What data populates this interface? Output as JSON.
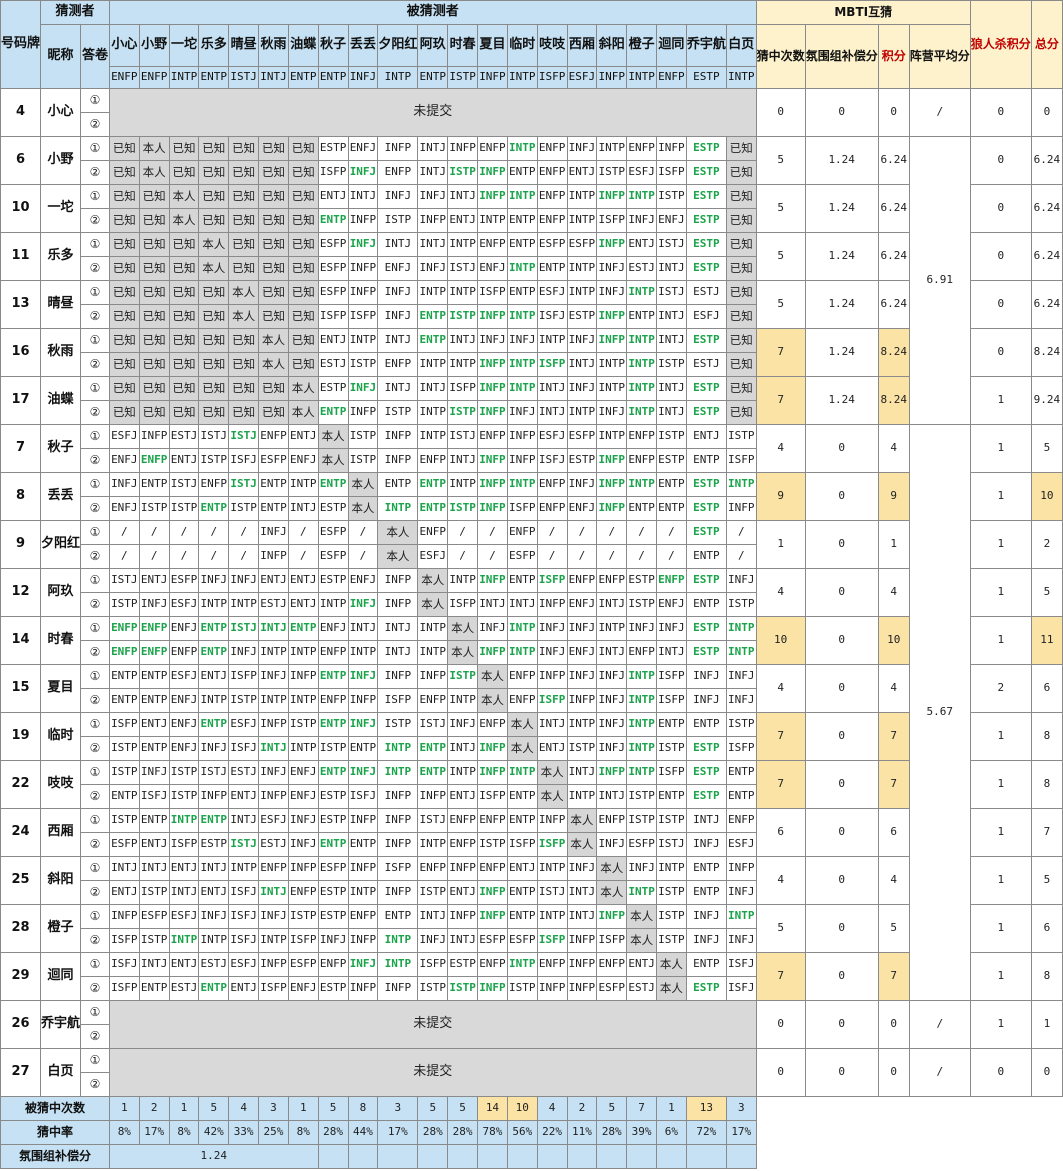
{
  "headers": {
    "id": "号码牌",
    "guesser": "猜测者",
    "nickname": "昵称",
    "sheet": "答卷",
    "guessed": "被猜测者",
    "mbti_section": "MBTI互猜",
    "hits": "猜中次数",
    "atmosphere": "氛围组补偿分",
    "points": "积分",
    "faction_avg": "阵营平均分",
    "wolf_points": "狼人杀积分",
    "total": "总分",
    "sheet_1": "①",
    "sheet_2": "②"
  },
  "columns": [
    {
      "name": "小心",
      "type": "ENFP"
    },
    {
      "name": "小野",
      "type": "ENFP"
    },
    {
      "name": "一坨",
      "type": "INTP"
    },
    {
      "name": "乐多",
      "type": "ENTP"
    },
    {
      "name": "晴昼",
      "type": "ISTJ"
    },
    {
      "name": "秋雨",
      "type": "INTJ"
    },
    {
      "name": "油蝶",
      "type": "ENTP"
    },
    {
      "name": "秋子",
      "type": "ENTP"
    },
    {
      "name": "丢丢",
      "type": "INFJ"
    },
    {
      "name": "夕阳红",
      "type": "INTP"
    },
    {
      "name": "阿玖",
      "type": "ENTP"
    },
    {
      "name": "时春",
      "type": "ISTP"
    },
    {
      "name": "夏目",
      "type": "INFP"
    },
    {
      "name": "临时",
      "type": "INTP"
    },
    {
      "name": "吱吱",
      "type": "ISFP"
    },
    {
      "name": "西厢",
      "type": "ESFJ"
    },
    {
      "name": "斜阳",
      "type": "INFP"
    },
    {
      "name": "橙子",
      "type": "INTP"
    },
    {
      "name": "迴同",
      "type": "ENFP"
    },
    {
      "name": "乔宇航",
      "type": "ESTP"
    },
    {
      "name": "白页",
      "type": "INTP"
    }
  ],
  "players": [
    {
      "id": "4",
      "name": "小心",
      "not_submitted": true,
      "not_submitted_label": "未提交",
      "hits": "0",
      "atmo": "0",
      "points": "0",
      "avg": "/",
      "wolf": "0",
      "total": "0"
    },
    {
      "id": "6",
      "name": "小野",
      "hits": "5",
      "atmo": "1.24",
      "points": "6.24",
      "wolf": "0",
      "total": "6.24",
      "s1": [
        "已知",
        "本人",
        "已知",
        "已知",
        "已知",
        "已知",
        "已知",
        "ESTP",
        "ENFJ",
        "INFP",
        "INTJ",
        "INFP",
        "ENFP",
        "INTP",
        "ENFP",
        "INFJ",
        "INTP",
        "ENFP",
        "INFP",
        "ESTP",
        "已知"
      ],
      "s2": [
        "已知",
        "本人",
        "已知",
        "已知",
        "已知",
        "已知",
        "已知",
        "ISFP",
        "INFJ",
        "ENFP",
        "INTJ",
        "ISTP",
        "INFP",
        "ENTP",
        "ENFP",
        "ENTJ",
        "ISTP",
        "ESFJ",
        "ISFP",
        "ESTP",
        "已知"
      ]
    },
    {
      "id": "10",
      "name": "一坨",
      "hits": "5",
      "atmo": "1.24",
      "points": "6.24",
      "wolf": "0",
      "total": "6.24",
      "s1": [
        "已知",
        "已知",
        "本人",
        "已知",
        "已知",
        "已知",
        "已知",
        "ENTJ",
        "INTJ",
        "INFJ",
        "INFJ",
        "INTJ",
        "INFP",
        "INTP",
        "ENFP",
        "INTP",
        "INFP",
        "INTP",
        "ISTP",
        "ESTP",
        "已知"
      ],
      "s2": [
        "已知",
        "已知",
        "本人",
        "已知",
        "已知",
        "已知",
        "已知",
        "ENTP",
        "INFP",
        "ISTP",
        "INFP",
        "ENTJ",
        "INTP",
        "ENTP",
        "ENFP",
        "INTP",
        "ISFP",
        "INFJ",
        "ENFJ",
        "ESTP",
        "已知"
      ]
    },
    {
      "id": "11",
      "name": "乐多",
      "hits": "5",
      "atmo": "1.24",
      "points": "6.24",
      "wolf": "0",
      "total": "6.24",
      "s1": [
        "已知",
        "已知",
        "已知",
        "本人",
        "已知",
        "已知",
        "已知",
        "ESFP",
        "INFJ",
        "INTJ",
        "INTJ",
        "INTP",
        "ENFP",
        "ENTP",
        "ESFP",
        "ESFP",
        "INFP",
        "ENTJ",
        "ISTJ",
        "ESTP",
        "已知"
      ],
      "s2": [
        "已知",
        "已知",
        "已知",
        "本人",
        "已知",
        "已知",
        "已知",
        "ESFP",
        "INFP",
        "ENFJ",
        "INFJ",
        "ISTJ",
        "ENFJ",
        "INTP",
        "ENTP",
        "INTP",
        "INFJ",
        "ESTJ",
        "INTJ",
        "ESTP",
        "已知"
      ]
    },
    {
      "id": "13",
      "name": "晴昼",
      "hits": "5",
      "atmo": "1.24",
      "points": "6.24",
      "wolf": "0",
      "total": "6.24",
      "s1": [
        "已知",
        "已知",
        "已知",
        "已知",
        "本人",
        "已知",
        "已知",
        "ESFP",
        "INFP",
        "INFJ",
        "INTP",
        "INTP",
        "ISFP",
        "ENTP",
        "ESFJ",
        "INTP",
        "INFJ",
        "INTP",
        "ISTJ",
        "ESTJ",
        "已知"
      ],
      "s2": [
        "已知",
        "已知",
        "已知",
        "已知",
        "本人",
        "已知",
        "已知",
        "ISFP",
        "ISFP",
        "INFJ",
        "ENTP",
        "ISTP",
        "INFP",
        "INTP",
        "ISFJ",
        "ESTP",
        "INFP",
        "ENTP",
        "INTJ",
        "ESFJ",
        "已知"
      ]
    },
    {
      "id": "16",
      "name": "秋雨",
      "hits": "7",
      "atmo": "1.24",
      "points": "8.24",
      "wolf": "0",
      "total": "8.24",
      "hy": true,
      "s1": [
        "已知",
        "已知",
        "已知",
        "已知",
        "已知",
        "本人",
        "已知",
        "ENTJ",
        "INTP",
        "INTJ",
        "ENTP",
        "INTJ",
        "INFJ",
        "INFJ",
        "INTP",
        "INFJ",
        "INFP",
        "INTP",
        "INTJ",
        "ESTP",
        "已知"
      ],
      "s2": [
        "已知",
        "已知",
        "已知",
        "已知",
        "已知",
        "本人",
        "已知",
        "ESTJ",
        "ISTP",
        "ENFP",
        "INTP",
        "INTP",
        "INFP",
        "INTP",
        "ISFP",
        "INTJ",
        "INTP",
        "INTP",
        "ISTP",
        "ESTJ",
        "已知"
      ]
    },
    {
      "id": "17",
      "name": "油蝶",
      "hits": "7",
      "atmo": "1.24",
      "points": "8.24",
      "wolf": "1",
      "total": "9.24",
      "hy": true,
      "s1": [
        "已知",
        "已知",
        "已知",
        "已知",
        "已知",
        "已知",
        "本人",
        "ESTP",
        "INFJ",
        "INTJ",
        "INTJ",
        "ISFP",
        "INFP",
        "INTP",
        "INTJ",
        "INFJ",
        "INTP",
        "INTP",
        "INTJ",
        "ESTP",
        "已知"
      ],
      "s2": [
        "已知",
        "已知",
        "已知",
        "已知",
        "已知",
        "已知",
        "本人",
        "ENTP",
        "INFP",
        "ISTP",
        "INTP",
        "ISTP",
        "INFP",
        "INFJ",
        "INTJ",
        "INTP",
        "INFJ",
        "INTP",
        "INTJ",
        "ESTP",
        "已知"
      ]
    },
    {
      "id": "7",
      "name": "秋子",
      "hits": "4",
      "atmo": "0",
      "points": "4",
      "wolf": "1",
      "total": "5",
      "s1": [
        "ESFJ",
        "INFP",
        "ESTJ",
        "ISTJ",
        "ISTJ",
        "ENFP",
        "ENTJ",
        "本人",
        "ISTP",
        "INFP",
        "INTP",
        "ISTJ",
        "ENFP",
        "INFP",
        "ESFJ",
        "ESFP",
        "INTP",
        "ENFP",
        "ISTP",
        "ENTJ",
        "ISTP"
      ],
      "s2": [
        "ENFJ",
        "ENFP",
        "ENTJ",
        "ISTP",
        "ISFJ",
        "ESFP",
        "ENFJ",
        "本人",
        "ISTP",
        "INFP",
        "ENFP",
        "INTJ",
        "INFP",
        "INFP",
        "ISFJ",
        "ESTP",
        "INFP",
        "ENFP",
        "ESTP",
        "ENTP",
        "ISFP"
      ]
    },
    {
      "id": "8",
      "name": "丢丢",
      "hits": "9",
      "atmo": "0",
      "points": "9",
      "wolf": "1",
      "total": "10",
      "hy": true,
      "ty": true,
      "s1": [
        "INFJ",
        "ENTP",
        "ISTJ",
        "ENFP",
        "ISTJ",
        "ENTP",
        "INTP",
        "ENTP",
        "本人",
        "ENTP",
        "ENTP",
        "INTP",
        "INFP",
        "INTP",
        "ENFP",
        "INFJ",
        "INFP",
        "INTP",
        "ENTP",
        "ESTP",
        "INTP"
      ],
      "s2": [
        "ENFJ",
        "ISTP",
        "ISTP",
        "ENTP",
        "ISTP",
        "ENTP",
        "INTJ",
        "ESTP",
        "本人",
        "INTP",
        "ENTP",
        "ISTP",
        "INFP",
        "ISFP",
        "ENFP",
        "ENFJ",
        "INFP",
        "ENTP",
        "ENTP",
        "ESTP",
        "INFP"
      ]
    },
    {
      "id": "9",
      "name": "夕阳红",
      "hits": "1",
      "atmo": "0",
      "points": "1",
      "wolf": "1",
      "total": "2",
      "s1": [
        "/",
        "/",
        "/",
        "/",
        "/",
        "INFJ",
        "/",
        "ESFP",
        "/",
        "本人",
        "ENFP",
        "/",
        "/",
        "ENFP",
        "/",
        "/",
        "/",
        "/",
        "/",
        "ESTP",
        "/"
      ],
      "s2": [
        "/",
        "/",
        "/",
        "/",
        "/",
        "INFP",
        "/",
        "ESFP",
        "/",
        "本人",
        "ESFJ",
        "/",
        "/",
        "ESFP",
        "/",
        "/",
        "/",
        "/",
        "/",
        "ENTP",
        "/"
      ]
    },
    {
      "id": "12",
      "name": "阿玖",
      "hits": "4",
      "atmo": "0",
      "points": "4",
      "wolf": "1",
      "total": "5",
      "s1": [
        "ISTJ",
        "ENTJ",
        "ESFP",
        "INFJ",
        "INFJ",
        "ENTJ",
        "ENTJ",
        "ESTP",
        "ENFJ",
        "INFP",
        "本人",
        "INTP",
        "INFP",
        "ENTP",
        "ISFP",
        "ENFP",
        "ENFP",
        "ESTP",
        "ENFP",
        "ESTP",
        "INFJ"
      ],
      "s2": [
        "ISTP",
        "INFJ",
        "ESFJ",
        "INTP",
        "INTP",
        "ESTJ",
        "ENTJ",
        "INTP",
        "INFJ",
        "INFP",
        "本人",
        "ISFP",
        "INTJ",
        "INTJ",
        "INFP",
        "ENFJ",
        "INTJ",
        "ISTP",
        "ENFJ",
        "ENTP",
        "ISTP"
      ]
    },
    {
      "id": "14",
      "name": "时春",
      "hits": "10",
      "atmo": "0",
      "points": "10",
      "wolf": "1",
      "total": "11",
      "hy": true,
      "ty": true,
      "s1": [
        "ENFP",
        "ENFP",
        "ENFJ",
        "ENTP",
        "ISTJ",
        "INTJ",
        "ENTP",
        "ENFJ",
        "INTJ",
        "INTJ",
        "INTP",
        "本人",
        "INFJ",
        "INTP",
        "INFJ",
        "INFJ",
        "INTP",
        "INFJ",
        "INFJ",
        "ESTP",
        "INTP"
      ],
      "s2": [
        "ENFP",
        "ENFP",
        "ENFP",
        "ENTP",
        "INFJ",
        "INTP",
        "INTP",
        "ENFP",
        "INTP",
        "INTJ",
        "INTP",
        "本人",
        "INFP",
        "INTP",
        "INFJ",
        "ENFJ",
        "INTJ",
        "ENFP",
        "INTJ",
        "ESTP",
        "INTP"
      ]
    },
    {
      "id": "15",
      "name": "夏目",
      "hits": "4",
      "atmo": "0",
      "points": "4",
      "wolf": "2",
      "total": "6",
      "s1": [
        "ENTP",
        "ENTP",
        "ESFJ",
        "ENTJ",
        "ISFP",
        "INFJ",
        "INFP",
        "ENTP",
        "INFJ",
        "INFP",
        "INFP",
        "ISTP",
        "本人",
        "ENFP",
        "INFP",
        "INFJ",
        "INFJ",
        "INTP",
        "ISFP",
        "INFJ",
        "INFJ"
      ],
      "s2": [
        "ENTP",
        "ENTP",
        "ENFJ",
        "INTP",
        "ISTP",
        "INTP",
        "INTP",
        "ENFP",
        "INFP",
        "ISFP",
        "ENFP",
        "INTP",
        "本人",
        "ENFP",
        "ISFP",
        "INFP",
        "INFJ",
        "INTP",
        "ISFP",
        "INFJ",
        "INFJ"
      ]
    },
    {
      "id": "19",
      "name": "临时",
      "hits": "7",
      "atmo": "0",
      "points": "7",
      "wolf": "1",
      "total": "8",
      "hy": true,
      "s1": [
        "ISFP",
        "ENTJ",
        "ENFJ",
        "ENTP",
        "ESFJ",
        "INFP",
        "ISTP",
        "ENTP",
        "INFJ",
        "ISTP",
        "ISTJ",
        "INFJ",
        "ENFP",
        "本人",
        "INTJ",
        "INTP",
        "INFJ",
        "INTP",
        "ENTP",
        "ENTP",
        "ISTP"
      ],
      "s2": [
        "ISTP",
        "ENTP",
        "ENFJ",
        "INFJ",
        "ISFJ",
        "INTJ",
        "INTP",
        "ISTP",
        "ENTP",
        "INTP",
        "ENTP",
        "INTJ",
        "INFP",
        "本人",
        "ENTJ",
        "ISTP",
        "INFJ",
        "INTP",
        "ISTP",
        "ESTP",
        "ISFP"
      ]
    },
    {
      "id": "22",
      "name": "吱吱",
      "hits": "7",
      "atmo": "0",
      "points": "7",
      "wolf": "1",
      "total": "8",
      "hy": true,
      "s1": [
        "ISTP",
        "INFJ",
        "ISTP",
        "ISTJ",
        "ESTJ",
        "INFJ",
        "ENFJ",
        "ENTP",
        "INFJ",
        "INTP",
        "ENTP",
        "INTP",
        "INFP",
        "INTP",
        "本人",
        "INTJ",
        "INFP",
        "INTP",
        "ISFP",
        "ESTP",
        "ENTP"
      ],
      "s2": [
        "ENTP",
        "ISFJ",
        "ISTP",
        "INFP",
        "ENTJ",
        "INFP",
        "ENFJ",
        "ESTP",
        "ISFJ",
        "INFP",
        "INFP",
        "ENTJ",
        "ISFP",
        "ENTP",
        "本人",
        "INTP",
        "INTJ",
        "ISTP",
        "ENTP",
        "ESTP",
        "ENTP"
      ]
    },
    {
      "id": "24",
      "name": "西厢",
      "hits": "6",
      "atmo": "0",
      "points": "6",
      "wolf": "1",
      "total": "7",
      "s1": [
        "ISTP",
        "ENTP",
        "INTP",
        "ENTP",
        "INTJ",
        "ESFJ",
        "INFJ",
        "ESTP",
        "INFP",
        "INFP",
        "ISTJ",
        "ENFP",
        "ENFP",
        "ENTP",
        "INFP",
        "本人",
        "ENFP",
        "ISTP",
        "ISTP",
        "INTJ",
        "ENFP"
      ],
      "s2": [
        "ESFP",
        "ENTJ",
        "ISFP",
        "ESTP",
        "ISTJ",
        "ESTJ",
        "INFJ",
        "ENTP",
        "ENTP",
        "INFP",
        "INTP",
        "ENFP",
        "ISTP",
        "ISFP",
        "ISFP",
        "本人",
        "INFJ",
        "ESFP",
        "ISTJ",
        "INFJ",
        "ESFJ"
      ]
    },
    {
      "id": "25",
      "name": "斜阳",
      "hits": "4",
      "atmo": "0",
      "points": "4",
      "wolf": "1",
      "total": "5",
      "s1": [
        "INTJ",
        "INTJ",
        "ENTJ",
        "INTJ",
        "INTP",
        "ENFP",
        "INFP",
        "ESFP",
        "INFP",
        "ISFP",
        "ENFP",
        "INFP",
        "ENFP",
        "ENTJ",
        "INTP",
        "INFJ",
        "本人",
        "INFJ",
        "INTP",
        "ENTP",
        "INFP"
      ],
      "s2": [
        "ENTJ",
        "ISTP",
        "INTJ",
        "ENTJ",
        "ISFJ",
        "INTJ",
        "ENFP",
        "ESTP",
        "INTP",
        "INFP",
        "ISTP",
        "ENTJ",
        "INFP",
        "ENTP",
        "ISTJ",
        "INTJ",
        "本人",
        "INTP",
        "ISTP",
        "ENTP",
        "INFJ"
      ]
    },
    {
      "id": "28",
      "name": "橙子",
      "hits": "5",
      "atmo": "0",
      "points": "5",
      "wolf": "1",
      "total": "6",
      "s1": [
        "INFP",
        "ESFP",
        "ESFJ",
        "INFJ",
        "ISFJ",
        "INFJ",
        "ISTP",
        "ESTP",
        "ENFP",
        "ENTP",
        "INTJ",
        "INFP",
        "INFP",
        "ENTP",
        "INTP",
        "INTJ",
        "INFP",
        "本人",
        "ISTP",
        "INFJ",
        "INTP"
      ],
      "s2": [
        "ISFP",
        "ISTP",
        "INTP",
        "INTP",
        "ISFJ",
        "INTP",
        "ISFP",
        "INFJ",
        "INFP",
        "INTP",
        "INFJ",
        "INTJ",
        "ESFP",
        "ESFP",
        "ISFP",
        "INFP",
        "ISFP",
        "本人",
        "ISTP",
        "INFJ",
        "INFJ"
      ]
    },
    {
      "id": "29",
      "name": "迴同",
      "hits": "7",
      "atmo": "0",
      "points": "7",
      "wolf": "1",
      "total": "8",
      "hy": true,
      "s1": [
        "ISFJ",
        "INTJ",
        "ENTJ",
        "ESTJ",
        "ESFJ",
        "INFP",
        "ESFP",
        "ENFP",
        "INFJ",
        "INTP",
        "ISFP",
        "ESTP",
        "ENFP",
        "INTP",
        "ENFP",
        "INFP",
        "ENFP",
        "ENTJ",
        "本人",
        "ENTP",
        "ISFJ"
      ],
      "s2": [
        "ISFP",
        "ENTP",
        "ESTJ",
        "ENTP",
        "ENTJ",
        "ISFP",
        "ENFJ",
        "ESTP",
        "INFP",
        "INFP",
        "ISTP",
        "ISTP",
        "INFP",
        "ISTP",
        "INFP",
        "INFP",
        "ESFP",
        "ESTJ",
        "本人",
        "ESTP",
        "ISFJ"
      ]
    },
    {
      "id": "26",
      "name": "乔宇航",
      "not_submitted": true,
      "not_submitted_label": "未提交",
      "hits": "0",
      "atmo": "0",
      "points": "0",
      "avg": "/",
      "wolf": "1",
      "total": "1"
    },
    {
      "id": "27",
      "name": "白页",
      "not_submitted": true,
      "not_submitted_label": "未提交",
      "hits": "0",
      "atmo": "0",
      "points": "0",
      "avg": "/",
      "wolf": "0",
      "total": "0"
    }
  ],
  "group_avgs": [
    "6.91",
    "5.67"
  ],
  "footer": {
    "times_label": "被猜中次数",
    "rate_label": "猜中率",
    "atmo_label": "氛围组补偿分",
    "atmo_value": "1.24",
    "times": [
      "1",
      "2",
      "1",
      "5",
      "4",
      "3",
      "1",
      "5",
      "8",
      "3",
      "5",
      "5",
      "14",
      "10",
      "4",
      "2",
      "5",
      "7",
      "1",
      "13",
      "3"
    ],
    "rates": [
      "8%",
      "17%",
      "8%",
      "42%",
      "33%",
      "25%",
      "8%",
      "28%",
      "44%",
      "17%",
      "28%",
      "28%",
      "78%",
      "56%",
      "22%",
      "11%",
      "28%",
      "39%",
      "6%",
      "72%",
      "17%"
    ],
    "highlight_cols": [
      12,
      13,
      19
    ]
  },
  "colors": {
    "header_blue": "#c5e1f3",
    "header_yellow": "#fdf2cc",
    "highlight_yellow": "#fbe3a5",
    "known_gray": "#d6d6d6",
    "not_submitted_gray": "#d9d9d9",
    "correct_green": "#1aa34a",
    "red_label": "#c00000"
  }
}
